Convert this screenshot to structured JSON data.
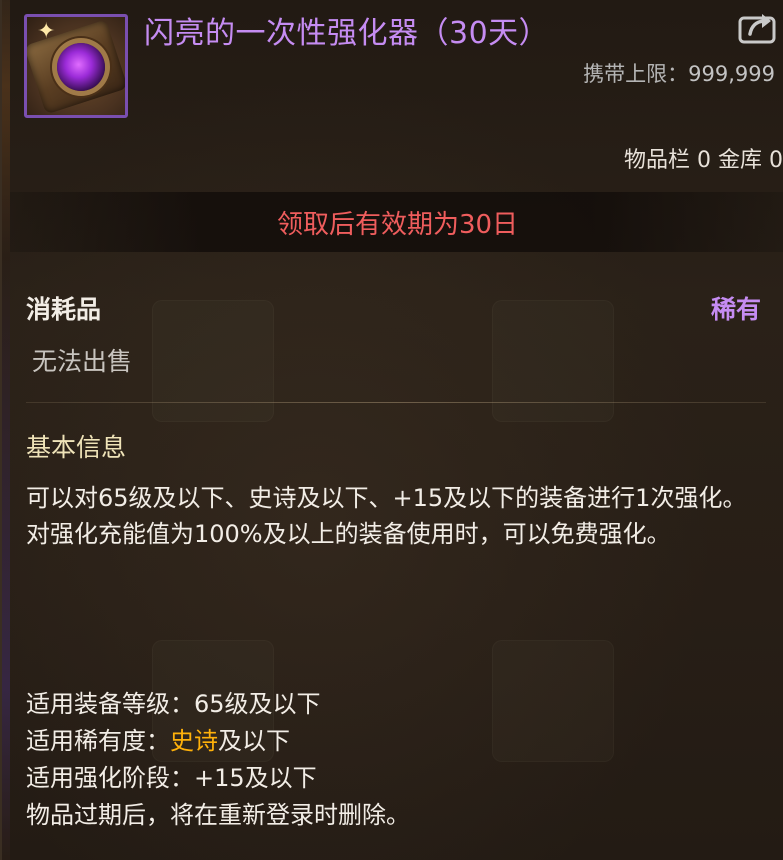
{
  "item": {
    "title": "闪亮的一次性强化器（30天）",
    "rarity_color": "#c58cf2",
    "icon": "enhancer-box-icon"
  },
  "carry_limit": {
    "label": "携带上限：",
    "value": "999,999"
  },
  "storage": {
    "inventory_label": "物品栏",
    "inventory_count": "0",
    "vault_label": "金库",
    "vault_count": "0"
  },
  "validity": {
    "text": "领取后有效期为30日",
    "color": "#ef5d5d"
  },
  "category": "消耗品",
  "rarity": "稀有",
  "tradability": "无法出售",
  "basic_info": {
    "title": "基本信息",
    "description": [
      "可以对65级及以下、史诗及以下、+15及以下的装备进行1次强化。",
      "对强化充能值为100%及以上的装备使用时，可以免费强化。"
    ]
  },
  "specs": {
    "level_label": "适用装备等级：",
    "level_value": "65级及以下",
    "rarity_label": "适用稀有度：",
    "rarity_highlight": "史诗",
    "rarity_suffix": "及以下",
    "rarity_highlight_color": "#ffb10a",
    "stage_label": "适用强化阶段：",
    "stage_value": "+15及以下",
    "expiry_note": "物品过期后，将在重新登录时删除。"
  }
}
